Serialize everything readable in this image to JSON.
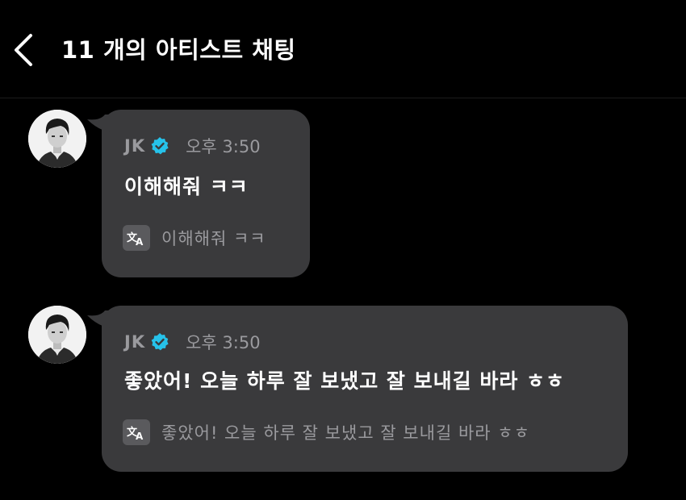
{
  "header": {
    "title": "11 개의 아티스트 채팅"
  },
  "messages": [
    {
      "sender": "JK",
      "time": "오후 3:50",
      "text": "이해해줘 ㅋㅋ",
      "translation": "이해해줘 ㅋㅋ"
    },
    {
      "sender": "JK",
      "time": "오후 3:50",
      "text": "좋았어! 오늘 하루 잘 보냈고 잘 보내길 바라 ㅎㅎ",
      "translation": "좋았어! 오늘 하루 잘 보냈고 잘 보내길 바라 ㅎㅎ"
    }
  ],
  "icons": {
    "back": "chevron-left-icon",
    "verified": "verified-badge-icon",
    "translate": "translate-icon"
  },
  "colors": {
    "background": "#000000",
    "bubble": "#3a3a3c",
    "verified": "#26c2ea",
    "meta_text": "#9a9a9e",
    "message_text": "#ffffff"
  }
}
